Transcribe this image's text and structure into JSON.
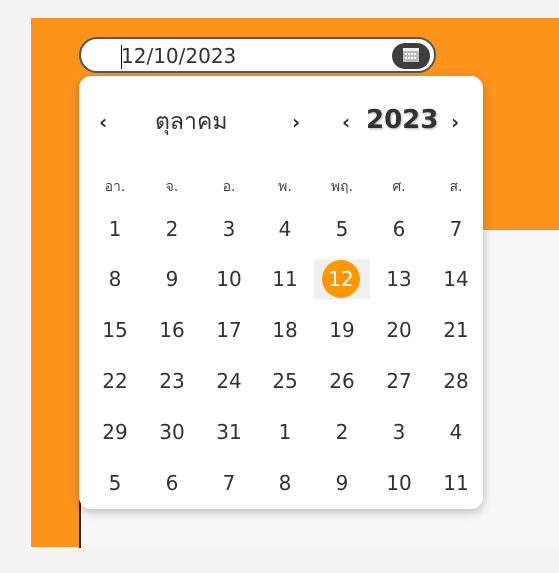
{
  "input": {
    "value": "12/10/2023"
  },
  "calendar": {
    "month": "ตุลาคม",
    "year": "2023",
    "prev_month": "‹",
    "next_month": "›",
    "prev_year": "‹",
    "next_year": "›",
    "weekdays": [
      "อา.",
      "จ.",
      "อ.",
      "พ.",
      "พฤ.",
      "ศ.",
      "ส."
    ],
    "weeks": [
      [
        "1",
        "2",
        "3",
        "4",
        "5",
        "6",
        "7"
      ],
      [
        "8",
        "9",
        "10",
        "11",
        "12",
        "13",
        "14"
      ],
      [
        "15",
        "16",
        "17",
        "18",
        "19",
        "20",
        "21"
      ],
      [
        "22",
        "23",
        "24",
        "25",
        "26",
        "27",
        "28"
      ],
      [
        "29",
        "30",
        "31",
        "1",
        "2",
        "3",
        "4"
      ],
      [
        "5",
        "6",
        "7",
        "8",
        "9",
        "10",
        "11"
      ]
    ],
    "selected_day": "12",
    "accent_color": "#ff9800"
  },
  "icons": {
    "calendar_button": "calendar-icon"
  }
}
